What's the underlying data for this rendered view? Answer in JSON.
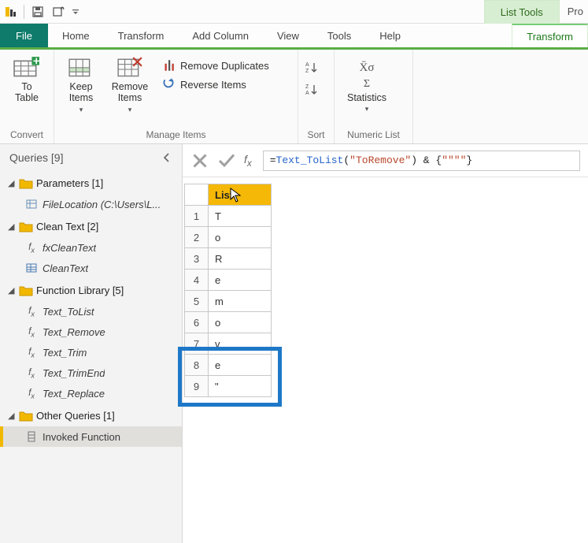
{
  "titlebar": {
    "list_tools_label": "List Tools",
    "product_truncated": "Pro"
  },
  "tabs": {
    "file": "File",
    "home": "Home",
    "transform1": "Transform",
    "add_column": "Add Column",
    "view": "View",
    "tools": "Tools",
    "help": "Help",
    "transform2": "Transform"
  },
  "ribbon": {
    "convert": {
      "to_table": "To\nTable",
      "group_label": "Convert"
    },
    "manage": {
      "keep_items": "Keep\nItems",
      "remove_items": "Remove\nItems",
      "remove_duplicates": "Remove Duplicates",
      "reverse_items": "Reverse Items",
      "group_label": "Manage Items"
    },
    "sort": {
      "group_label": "Sort"
    },
    "numeric": {
      "statistics": "Statistics",
      "group_label": "Numeric List"
    }
  },
  "sidebar": {
    "header": "Queries [9]",
    "groups": [
      {
        "label": "Parameters [1]",
        "items": [
          {
            "icon": "param",
            "label": "FileLocation (C:\\Users\\L..."
          }
        ]
      },
      {
        "label": "Clean Text [2]",
        "items": [
          {
            "icon": "fx",
            "label": "fxCleanText"
          },
          {
            "icon": "table",
            "label": "CleanText"
          }
        ]
      },
      {
        "label": "Function Library [5]",
        "items": [
          {
            "icon": "fx",
            "label": "Text_ToList"
          },
          {
            "icon": "fx",
            "label": "Text_Remove"
          },
          {
            "icon": "fx",
            "label": "Text_Trim"
          },
          {
            "icon": "fx",
            "label": "Text_TrimEnd"
          },
          {
            "icon": "fx",
            "label": "Text_Replace"
          }
        ]
      },
      {
        "label": "Other Queries [1]",
        "items": [
          {
            "icon": "list",
            "label": "Invoked Function",
            "selected": true
          }
        ]
      }
    ]
  },
  "formula": {
    "prefix": "= ",
    "fn": "Text_ToList",
    "open": "(",
    "arg": "\"ToRemove\"",
    "close": ") & {",
    "tail_str": "\"\"\"\"",
    "tail_close": "}"
  },
  "grid": {
    "column_header": "List",
    "rows": [
      {
        "n": "1",
        "v": "T"
      },
      {
        "n": "2",
        "v": "o"
      },
      {
        "n": "3",
        "v": "R"
      },
      {
        "n": "4",
        "v": "e"
      },
      {
        "n": "5",
        "v": "m"
      },
      {
        "n": "6",
        "v": "o"
      },
      {
        "n": "7",
        "v": "v"
      },
      {
        "n": "8",
        "v": "e"
      },
      {
        "n": "9",
        "v": "\""
      }
    ]
  }
}
